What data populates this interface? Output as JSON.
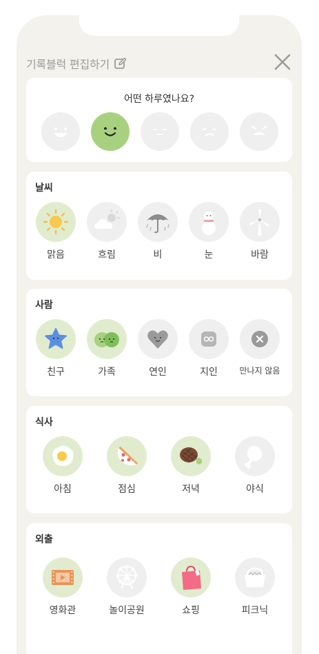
{
  "header": {
    "title": "기록블럭 편집하기",
    "edit_icon": "pencil-square-icon",
    "close_icon": "close-icon"
  },
  "mood": {
    "question": "어떤 하루였나요?",
    "selected_index": 1,
    "faces": [
      "very-happy-face-icon",
      "smile-face-icon",
      "neutral-face-icon",
      "sad-face-icon",
      "very-sad-face-icon"
    ],
    "accent": "#a8d17f"
  },
  "weather": {
    "title": "날씨",
    "items": [
      {
        "label": "맑음",
        "icon": "sun-icon",
        "selected": true
      },
      {
        "label": "흐림",
        "icon": "cloud-sun-icon",
        "selected": false
      },
      {
        "label": "비",
        "icon": "umbrella-rain-icon",
        "selected": false
      },
      {
        "label": "눈",
        "icon": "snowman-icon",
        "selected": false
      },
      {
        "label": "바람",
        "icon": "windmill-icon",
        "selected": false
      }
    ]
  },
  "people": {
    "title": "사람",
    "items": [
      {
        "label": "친구",
        "icon": "star-friend-icon",
        "selected": true
      },
      {
        "label": "가족",
        "icon": "family-icon",
        "selected": true
      },
      {
        "label": "연인",
        "icon": "heart-icon",
        "selected": false
      },
      {
        "label": "지인",
        "icon": "acquaintance-icon",
        "selected": false
      },
      {
        "label": "만나지 않음",
        "icon": "x-circle-icon",
        "selected": false
      }
    ]
  },
  "meal": {
    "title": "식사",
    "items": [
      {
        "label": "아침",
        "icon": "fried-egg-icon",
        "selected": true
      },
      {
        "label": "점심",
        "icon": "pizza-icon",
        "selected": true
      },
      {
        "label": "저녁",
        "icon": "steak-icon",
        "selected": true
      },
      {
        "label": "야식",
        "icon": "chicken-leg-icon",
        "selected": false
      }
    ]
  },
  "outing": {
    "title": "외출",
    "items": [
      {
        "label": "영화관",
        "icon": "movie-film-icon",
        "selected": true
      },
      {
        "label": "놀이공원",
        "icon": "ferris-wheel-icon",
        "selected": false
      },
      {
        "label": "쇼핑",
        "icon": "shopping-bag-icon",
        "selected": true
      },
      {
        "label": "피크닉",
        "icon": "picnic-basket-icon",
        "selected": false
      }
    ]
  },
  "colors": {
    "background": "#f3f2ed",
    "selected_circle": "#e1eccf",
    "unselected_circle": "#efefef"
  }
}
